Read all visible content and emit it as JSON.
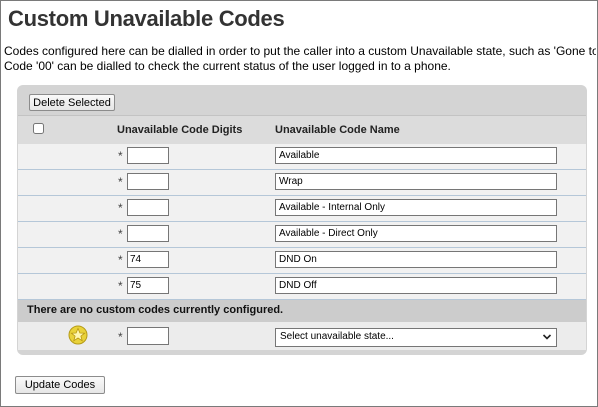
{
  "page": {
    "title": "Custom Unavailable Codes",
    "description_line1": "Codes configured here can be dialled in order to put the caller into a custom Unavailable state, such as 'Gone to",
    "description_line2": "Code '00' can be dialled to check the current status of the user logged in to a phone."
  },
  "toolbar": {
    "delete_label": "Delete Selected"
  },
  "table": {
    "header_digits": "Unavailable Code Digits",
    "header_name": "Unavailable Code Name",
    "required_mark": "*",
    "rows": [
      {
        "digits": "",
        "name": "Available"
      },
      {
        "digits": "",
        "name": "Wrap"
      },
      {
        "digits": "",
        "name": "Available - Internal Only"
      },
      {
        "digits": "",
        "name": "Available - Direct Only"
      },
      {
        "digits": "74",
        "name": "DND On"
      },
      {
        "digits": "75",
        "name": "DND Off"
      }
    ],
    "no_custom_codes": "There are no custom codes currently configured."
  },
  "new_code": {
    "digits": "",
    "state_select": "Select unavailable state...",
    "icon": "star-icon"
  },
  "footer": {
    "update_label": "Update Codes"
  },
  "colors": {
    "panel": "#d4d4d4",
    "row": "#f1f1f1",
    "row_border": "#b5c7d8",
    "star": "#f2d52a"
  }
}
